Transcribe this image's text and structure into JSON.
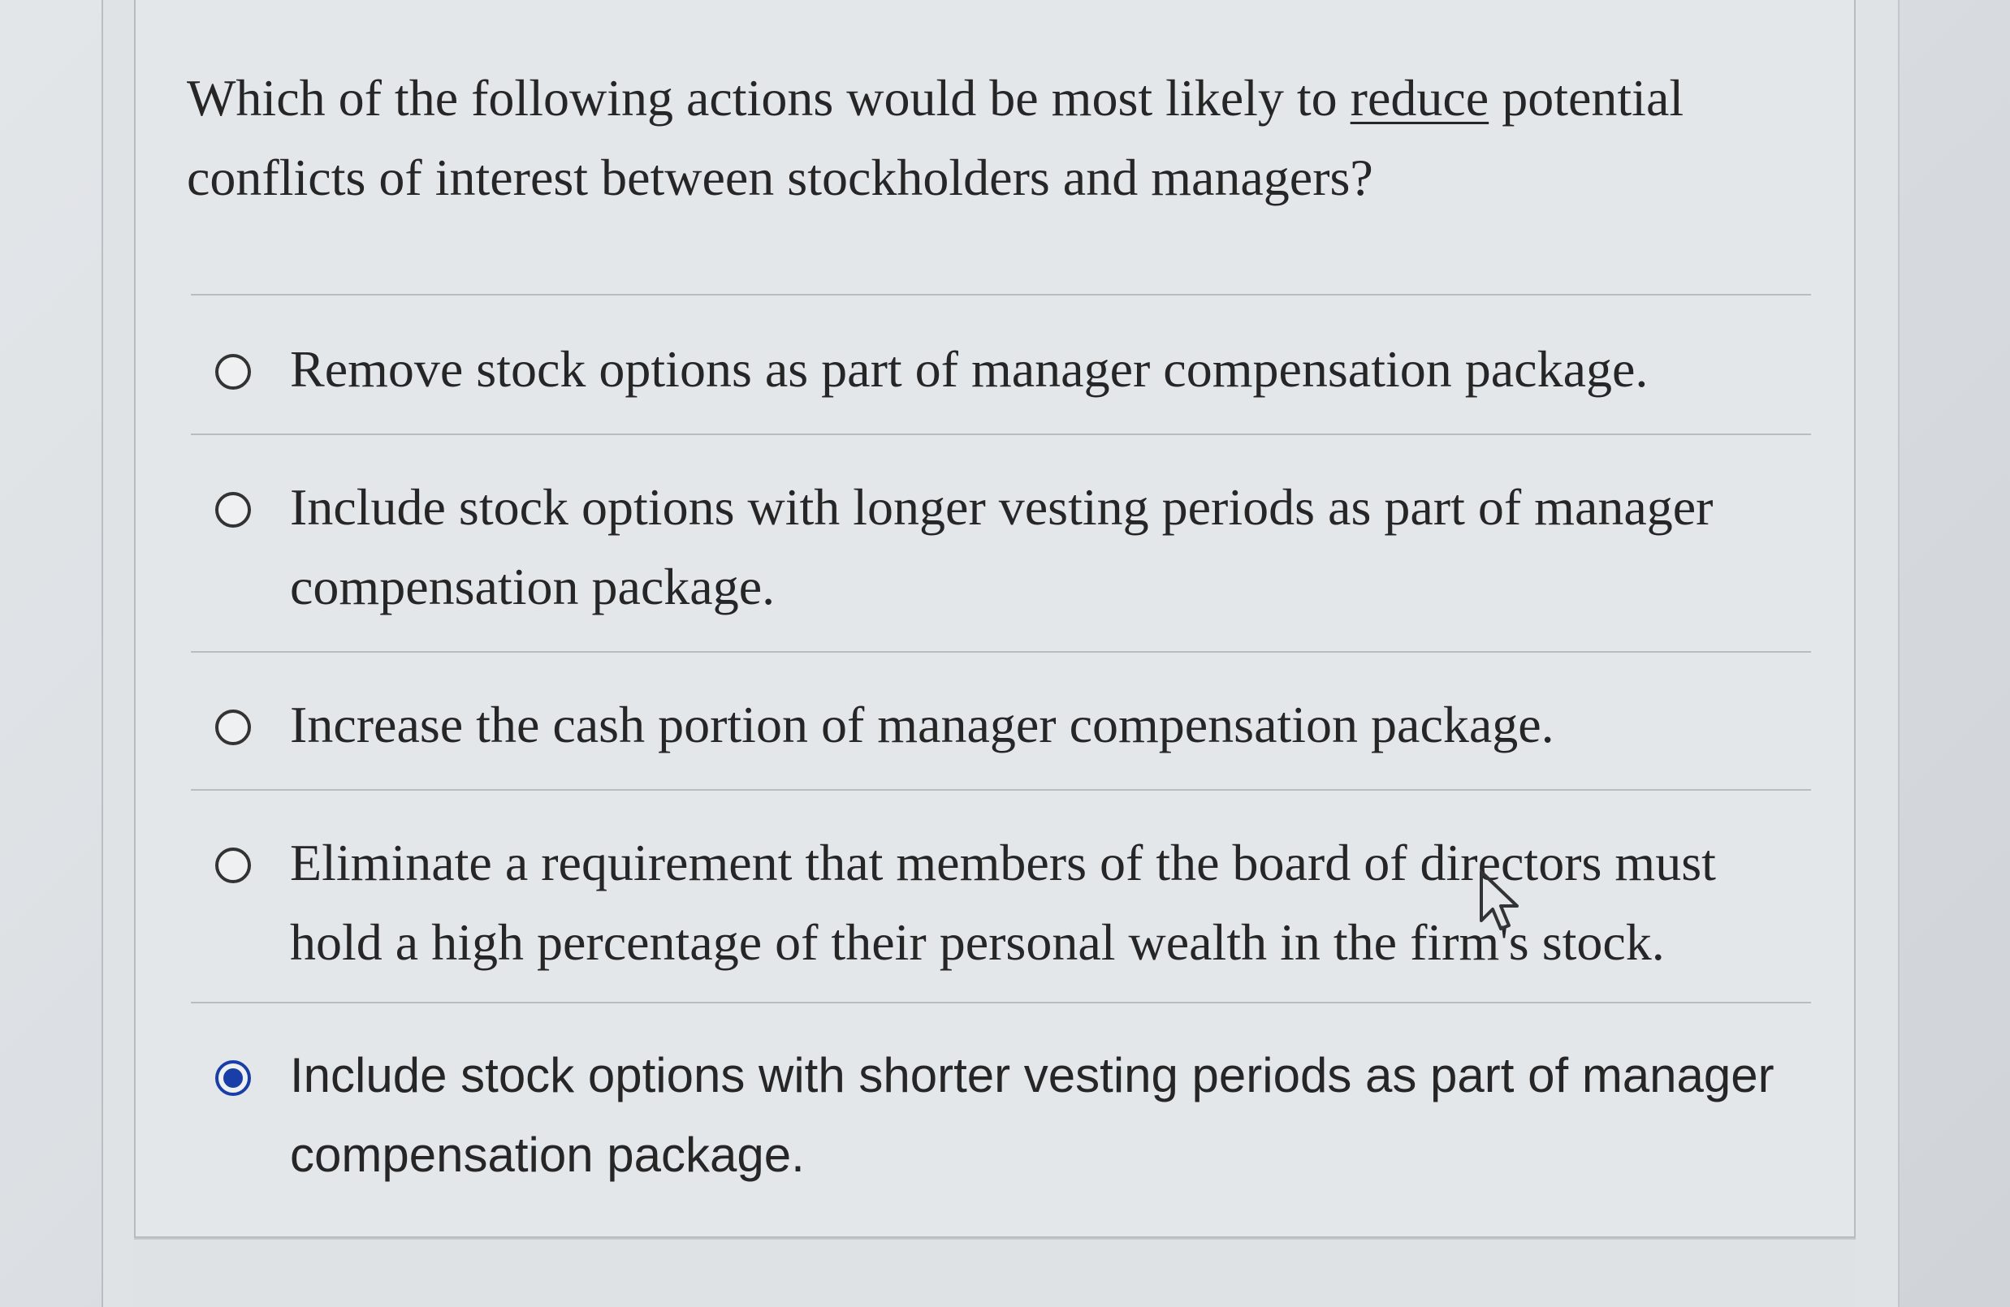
{
  "question": {
    "text_before": "Which of the following actions would be most likely to ",
    "emphasis": "reduce",
    "text_after": " potential conflicts of interest between stockholders and managers?"
  },
  "options": [
    {
      "label": "Remove stock options as part of manager compensation package.",
      "selected": false
    },
    {
      "label": "Include stock options with longer vesting periods as part of manager compensation package.",
      "selected": false
    },
    {
      "label": "Increase the cash portion of manager compensation package.",
      "selected": false
    },
    {
      "label": "Eliminate a requirement that members of the board of directors must hold a high percentage of their personal wealth in the firm's stock.",
      "selected": false
    },
    {
      "label": "Include stock options with shorter vesting periods as part of manager compensation package.",
      "selected": true
    }
  ],
  "colors": {
    "selected_radio": "#1a3ea8",
    "text": "#262626"
  },
  "icons": {
    "cursor": "mouse-pointer-icon"
  }
}
